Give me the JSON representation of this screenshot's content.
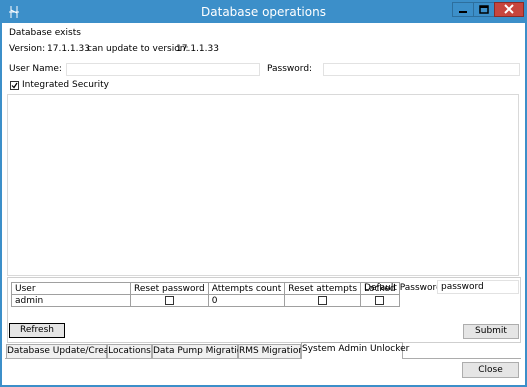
{
  "window": {
    "title": "Database operations"
  },
  "status": {
    "message": "Database exists",
    "version_label": "Version:",
    "version_value": "17.1.1.33",
    "update_label": "can update to version:",
    "update_value": "17.1.1.33"
  },
  "credentials": {
    "username_label": "User Name:",
    "username_value": "",
    "password_label": "Password:",
    "password_value": "",
    "integrated_security_label": "Integrated Security",
    "integrated_security_checked": true
  },
  "grid": {
    "headers": [
      "User",
      "Reset password",
      "Attempts count",
      "Reset attempts",
      "Locked"
    ],
    "rows": [
      {
        "user": "admin",
        "reset_password": false,
        "attempts_count": "0",
        "reset_attempts": false,
        "locked": false
      }
    ]
  },
  "default_password": {
    "label": "Default Password:",
    "value": "password"
  },
  "buttons": {
    "refresh": "Refresh",
    "submit": "Submit",
    "close": "Close"
  },
  "tabs": [
    {
      "label": "Database Update/Create",
      "active": false
    },
    {
      "label": "Locations",
      "active": false
    },
    {
      "label": "Data Pump Migration",
      "active": false
    },
    {
      "label": "RMS Migration",
      "active": false
    },
    {
      "label": "System Admin Unlocker",
      "active": true
    }
  ],
  "icons": {
    "app": "app-icon",
    "minimize": "minimize-icon",
    "maximize": "maximize-icon",
    "close": "close-icon"
  },
  "colors": {
    "titlebar": "#3c8fc9",
    "close_button": "#c7453d"
  }
}
